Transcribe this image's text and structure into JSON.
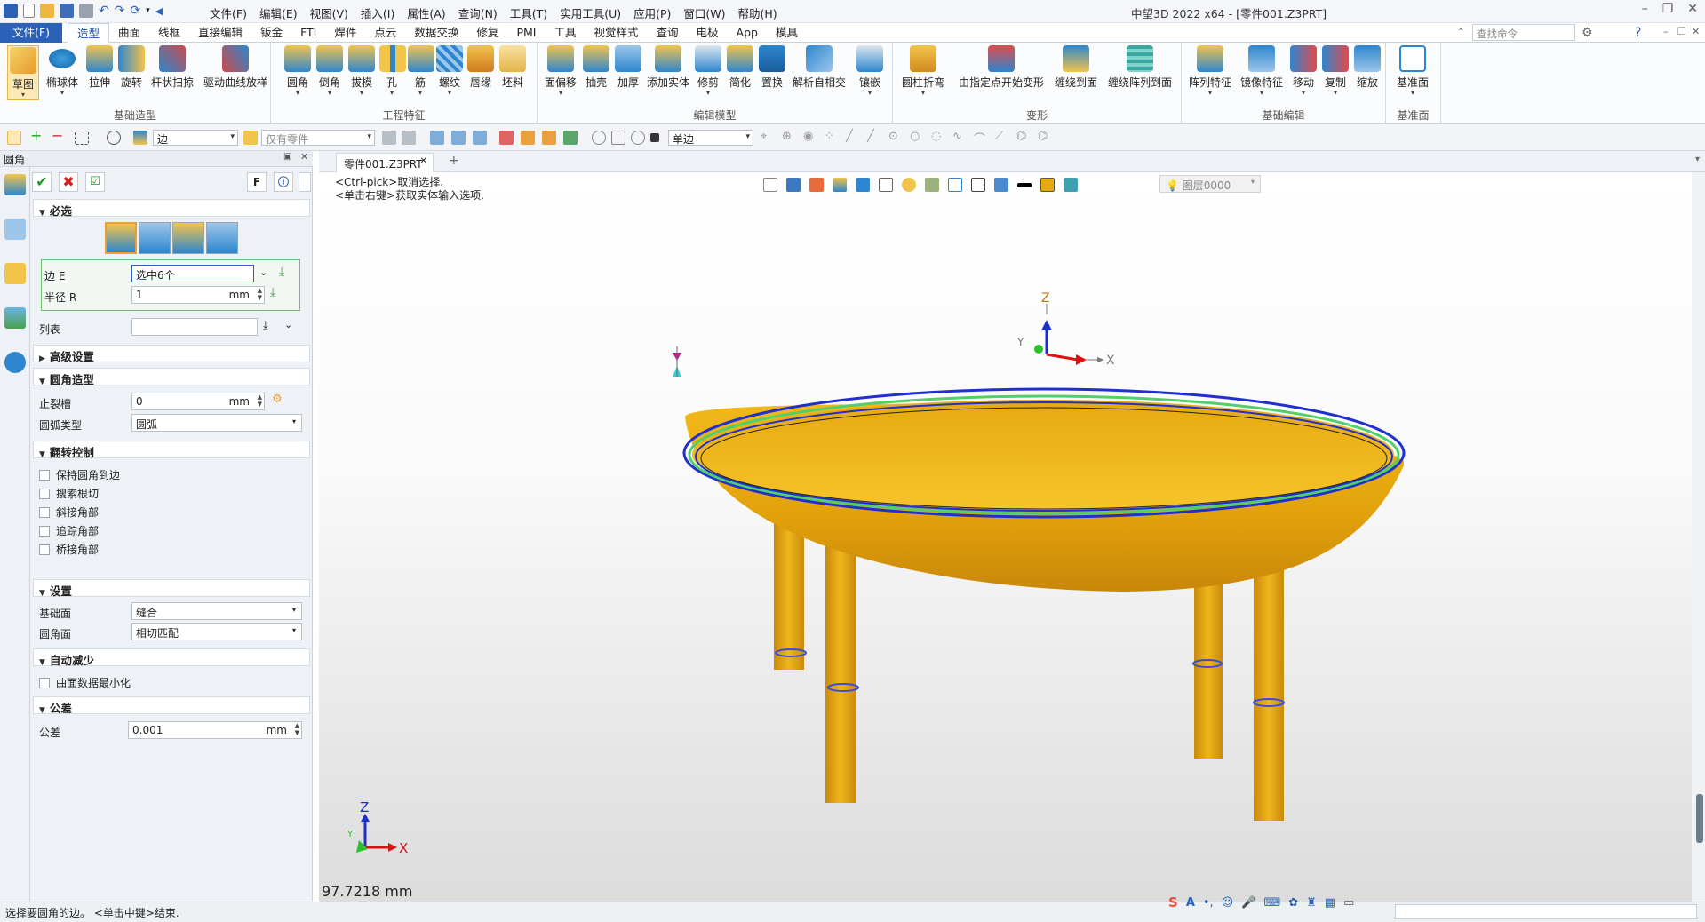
{
  "app_title": "中望3D 2022 x64 - [零件001.Z3PRT]",
  "menubar": [
    "文件(F)",
    "编辑(E)",
    "视图(V)",
    "插入(I)",
    "属性(A)",
    "查询(N)",
    "工具(T)",
    "实用工具(U)",
    "应用(P)",
    "窗口(W)",
    "帮助(H)"
  ],
  "ribbon_tabs": {
    "file": "文件(F)",
    "tabs": [
      "造型",
      "曲面",
      "线框",
      "直接编辑",
      "钣金",
      "FTI",
      "焊件",
      "点云",
      "数据交换",
      "修复",
      "PMI",
      "工具",
      "视觉样式",
      "查询",
      "电极",
      "App",
      "模具"
    ],
    "active": "造型"
  },
  "search": {
    "placeholder": "查找命令"
  },
  "ribbon": {
    "groups": [
      {
        "title": "基础造型",
        "buttons": [
          "草图",
          "椭球体",
          "拉伸",
          "旋转",
          "杆状扫掠",
          "驱动曲线放样"
        ]
      },
      {
        "title": "工程特征",
        "buttons": [
          "圆角",
          "倒角",
          "拔模",
          "孔",
          "筋",
          "螺纹",
          "唇缘",
          "坯料"
        ]
      },
      {
        "title": "编辑模型",
        "buttons": [
          "面偏移",
          "抽壳",
          "加厚",
          "添加实体",
          "修剪",
          "简化",
          "置换",
          "解析自相交",
          "镶嵌"
        ]
      },
      {
        "title": "变形",
        "buttons": [
          "圆柱折弯",
          "由指定点开始变形",
          "缠绕到面",
          "缠绕阵列到面"
        ]
      },
      {
        "title": "基础编辑",
        "buttons": [
          "阵列特征",
          "镜像特征",
          "移动",
          "复制",
          "缩放"
        ]
      },
      {
        "title": "基准面",
        "buttons": [
          "基准面"
        ]
      }
    ]
  },
  "selection_toolbar": {
    "filter": "边",
    "part_filter": "仅有零件",
    "mode": "单边"
  },
  "panel": {
    "title": "圆角",
    "f_label": "F",
    "required": {
      "header": "必选",
      "edge_label": "边 E",
      "edge_value": "选中6个",
      "radius_label": "半径 R",
      "radius_value": "1",
      "unit": "mm",
      "list_label": "列表"
    },
    "advanced_header": "高级设置",
    "shape": {
      "header": "圆角造型",
      "relief_label": "止裂槽",
      "relief_value": "0",
      "unit": "mm",
      "arc_type_label": "圆弧类型",
      "arc_type_value": "圆弧"
    },
    "rollover": {
      "header": "翻转控制",
      "options": [
        "保持圆角到边",
        "搜索根切",
        "斜接角部",
        "追踪角部",
        "桥接角部"
      ]
    },
    "settings": {
      "header": "设置",
      "base_label": "基础面",
      "base_value": "缝合",
      "fillet_face_label": "圆角面",
      "fillet_face_value": "相切匹配"
    },
    "auto_reduce": {
      "header": "自动减少",
      "option": "曲面数据最小化"
    },
    "tolerance": {
      "header": "公差",
      "label": "公差",
      "value": "0.001",
      "unit": "mm"
    }
  },
  "document_tab": "零件001.Z3PRT",
  "viewport": {
    "hint_line1": "<Ctrl-pick>取消选择.",
    "hint_line2": "<单击右键>获取实体输入选项.",
    "layer": "图层0000",
    "distance": "97.7218 mm",
    "axis_x": "X",
    "axis_y": "Y",
    "axis_z": "Z",
    "colors": {
      "body": "#e6a90e",
      "rim": "#1f2fd0",
      "rim_green": "#4fd06a"
    }
  },
  "status": {
    "text": "选择要圆角的边。 <单击中键>结束."
  }
}
